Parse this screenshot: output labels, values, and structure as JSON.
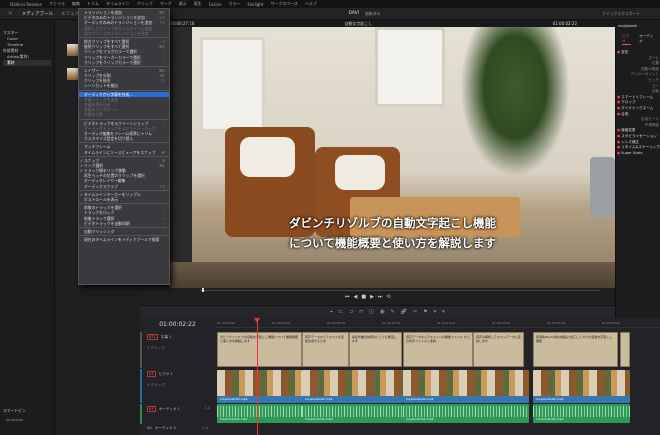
{
  "menubar": {
    "items": [
      "DaVinci Resolve",
      "ファイル",
      "編集",
      "トリム",
      "タイムライン",
      "クリップ",
      "マーク",
      "表示",
      "再生",
      "Fusion",
      "カラー",
      "Fairlight",
      "ワークスペース",
      "ヘルプ"
    ]
  },
  "toolbar": {
    "media_pool": "メディアプール",
    "effects": "エフェクト",
    "project": "DAVI",
    "project_status": "編集済み",
    "quick_export": "クイックエクスポート",
    "timeline_name": "自動文字起こし",
    "timecode": "01:00:02:22",
    "clip_name": "mojiokoshi"
  },
  "viewer": {
    "source_tc": "00:00:27:18",
    "subtitle_line1": "ダビンチリゾルブの自動文字起こし機能",
    "subtitle_line2": "について機能概要と使い方を解説します"
  },
  "left": {
    "items": [
      "マスター",
      "Cover",
      "Timeline",
      "外部素材",
      "Artlist(素材)",
      "素材"
    ],
    "smart_bins": "スマートビン",
    "keywords": "Keywords"
  },
  "menu": [
    {
      "label": "トランジションを追加",
      "sc": "⌘T"
    },
    {
      "label": "ビデオのみのトランジションを追加",
      "sc": "⌥T"
    },
    {
      "label": "オーディオのみのトランジションを追加",
      "sc": "⇧T"
    },
    {
      "label": "選択したクリップをタイムラインに追加",
      "dis": true
    },
    {
      "label": "前方クリップのトランジションを追加",
      "dis": true
    },
    {
      "sep": true
    },
    {
      "label": "前方クリップをすべて選択",
      "sc": "Y"
    },
    {
      "label": "後続クリップをすべて選択",
      "sc": "⌘Y"
    },
    {
      "label": "クリップをフラグカラーで選択",
      "sc": "›"
    },
    {
      "label": "クリップをマーカーカラーで選択",
      "sc": "›"
    },
    {
      "label": "クリップをクリップカラーで選択",
      "sc": "›"
    },
    {
      "sep": true
    },
    {
      "label": "レイザー",
      "sc": "⌘B"
    },
    {
      "label": "クリップを分割",
      "sc": "⌘\\"
    },
    {
      "label": "クリップを結合",
      "sc": "⌥\\"
    },
    {
      "label": "シーンカットを検出"
    },
    {
      "sep": true
    },
    {
      "label": "オーディオから字幕を作成...",
      "hl": true
    },
    {
      "label": "字幕トラックを追加",
      "dis": true
    },
    {
      "label": "字幕を読み込み",
      "dis": true
    },
    {
      "label": "字幕をエクスポート",
      "dis": true
    },
    {
      "label": "字幕を分割",
      "dis": true
    },
    {
      "sep": true
    },
    {
      "label": "ビデオトラックをスクリーンショップ",
      "sc": "›"
    },
    {
      "label": "オーディオトラックをスクリーンショップ",
      "dis": true
    },
    {
      "label": "オーディオ編集をフレーム境界にトリム"
    },
    {
      "label": "カスタマイズ設定を切り替え"
    },
    {
      "sep": true
    },
    {
      "label": "マッチフレーム"
    },
    {
      "label": "タイムラインにソースビューアをスナップ",
      "sc": "⌘"
    },
    {
      "sep": true
    },
    {
      "label": "スナップ",
      "chk": true,
      "sc": "N"
    },
    {
      "label": "リンク選択",
      "chk": true,
      "sc": "⌘L"
    },
    {
      "label": "トラック間をリンク移動",
      "chk": true
    },
    {
      "label": "再生ヘッドの位置のクリップを選択"
    },
    {
      "label": "オーディオレイヤー編集"
    },
    {
      "label": "オーディオスクラブ",
      "sc": "⇧S"
    },
    {
      "sep": true
    },
    {
      "label": "タイムラインマーカーをリップル",
      "chk": true
    },
    {
      "label": "ポストロールを表示"
    },
    {
      "sep": true
    },
    {
      "label": "前後のトラックを選択",
      "sc": "›"
    },
    {
      "label": "トラックをロック",
      "sc": "›"
    },
    {
      "label": "前後トラック選択",
      "sc": "›"
    },
    {
      "label": "ビデオトラックを自動同期",
      "sc": "›"
    },
    {
      "sep": true
    },
    {
      "label": "自動クリッシング",
      "sc": "›"
    },
    {
      "sep": true
    },
    {
      "label": "現在のタイムラインをメディアプールで検索"
    }
  ],
  "inspector": {
    "tabs": [
      "ビデオ",
      "オーディオ"
    ],
    "sections": [
      "変形",
      "ズーム",
      "位置",
      "回転の角度",
      "アンカーポイント",
      "ピッチ",
      "ヨー",
      "反転",
      "スマートリフレーム",
      "クロップ",
      "ダイナミックズーム",
      "合成",
      "合成モード",
      "不透明度",
      "速度変更",
      "スタビライゼーション",
      "レンズ補正",
      "リタイム&スケーリング",
      "Super Scale"
    ]
  },
  "timeline": {
    "timecode": "01:00:02:22",
    "ruler": [
      "01:00:00:00",
      "01:00:04:00",
      "01:00:08:00",
      "01:00:12:00",
      "01:00:16:00",
      "01:00:20:00",
      "01:00:24:00",
      "01:00:28:00"
    ],
    "tracks": {
      "st1": {
        "tag": "ST1",
        "name": "字幕 1",
        "clips": "7 クリップ"
      },
      "v1": {
        "tag": "V1",
        "name": "ビデオ 1",
        "clips": "4 クリップ"
      },
      "a1": {
        "tag": "A1",
        "name": "オーディオ 1",
        "level": "2.0"
      },
      "a2": {
        "tag": "A2",
        "name": "オーディオ 2",
        "level": "2.0"
      }
    },
    "subtitles": [
      "ダビンチリゾルブの自動文字起こし機能について機能概要と使い方を解説します",
      "音声データからテキストを自動生成するため",
      "編集作業の効率化にとても重宝します",
      "音声データからテキストへの機能ファイル からの音声ファイルに変換",
      "音声の解析しテキストデータに変換します",
      "有償版Studio版の動画に対応して AIでの自動文字起こし機能"
    ],
    "clip_file": "mojiokoshi02.mp4"
  }
}
